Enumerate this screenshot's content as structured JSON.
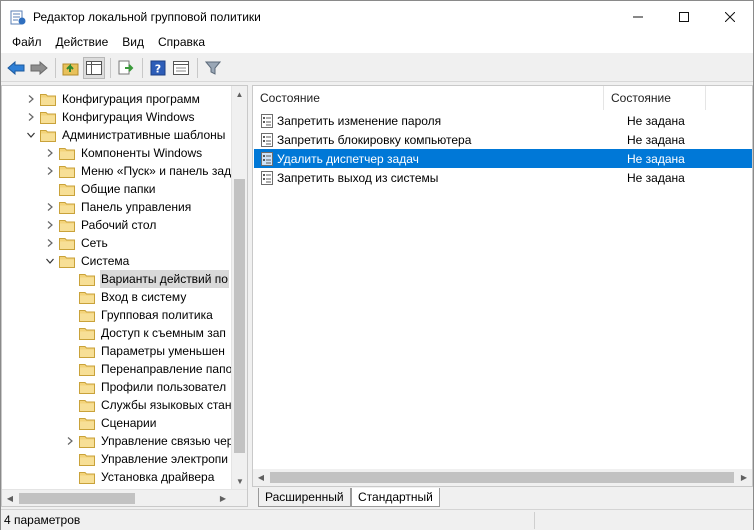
{
  "window": {
    "title": "Редактор локальной групповой политики",
    "controls": {
      "minimize": "minimize-icon",
      "maximize": "maximize-icon",
      "close": "close-icon"
    }
  },
  "menu": [
    "Файл",
    "Действие",
    "Вид",
    "Справка"
  ],
  "toolbar": [
    "back-arrow-icon",
    "forward-arrow-icon",
    "up-folder-icon",
    "show-hide-tree-icon",
    "export-list-icon",
    "help-icon",
    "properties-icon",
    "filter-icon"
  ],
  "tree": [
    {
      "label": "Конфигурация программ",
      "level": 1,
      "expander": "collapsed"
    },
    {
      "label": "Конфигурация Windows",
      "level": 1,
      "expander": "collapsed"
    },
    {
      "label": "Административные шаблоны",
      "level": 1,
      "expander": "expanded"
    },
    {
      "label": "Компоненты Windows",
      "level": 2,
      "expander": "collapsed"
    },
    {
      "label": "Меню «Пуск» и панель задач",
      "level": 2,
      "expander": "collapsed"
    },
    {
      "label": "Общие папки",
      "level": 2,
      "expander": "none"
    },
    {
      "label": "Панель управления",
      "level": 2,
      "expander": "collapsed"
    },
    {
      "label": "Рабочий стол",
      "level": 2,
      "expander": "collapsed"
    },
    {
      "label": "Сеть",
      "level": 2,
      "expander": "collapsed"
    },
    {
      "label": "Система",
      "level": 2,
      "expander": "expanded"
    },
    {
      "label": "Варианты действий по",
      "level": 3,
      "expander": "none",
      "selected": true
    },
    {
      "label": "Вход в систему",
      "level": 3,
      "expander": "none"
    },
    {
      "label": "Групповая политика",
      "level": 3,
      "expander": "none"
    },
    {
      "label": "Доступ к съемным зап",
      "level": 3,
      "expander": "none"
    },
    {
      "label": "Параметры уменьшен",
      "level": 3,
      "expander": "none"
    },
    {
      "label": "Перенаправление папо",
      "level": 3,
      "expander": "none"
    },
    {
      "label": "Профили пользовател",
      "level": 3,
      "expander": "none"
    },
    {
      "label": "Службы языковых стан",
      "level": 3,
      "expander": "none"
    },
    {
      "label": "Сценарии",
      "level": 3,
      "expander": "none"
    },
    {
      "label": "Управление связью чер",
      "level": 3,
      "expander": "collapsed"
    },
    {
      "label": "Управление электропи",
      "level": 3,
      "expander": "none"
    },
    {
      "label": "Установка драйвера",
      "level": 3,
      "expander": "none"
    }
  ],
  "list": {
    "columns": [
      "Состояние",
      "Состояние"
    ],
    "rows": [
      {
        "name": "Запретить изменение пароля",
        "state": "Не задана",
        "selected": false
      },
      {
        "name": "Запретить блокировку компьютера",
        "state": "Не задана",
        "selected": false
      },
      {
        "name": "Удалить диспетчер задач",
        "state": "Не задана",
        "selected": true
      },
      {
        "name": "Запретить выход из системы",
        "state": "Не задана",
        "selected": false
      }
    ]
  },
  "tabs": [
    "Расширенный",
    "Стандартный"
  ],
  "active_tab": 1,
  "status": "4 параметров"
}
